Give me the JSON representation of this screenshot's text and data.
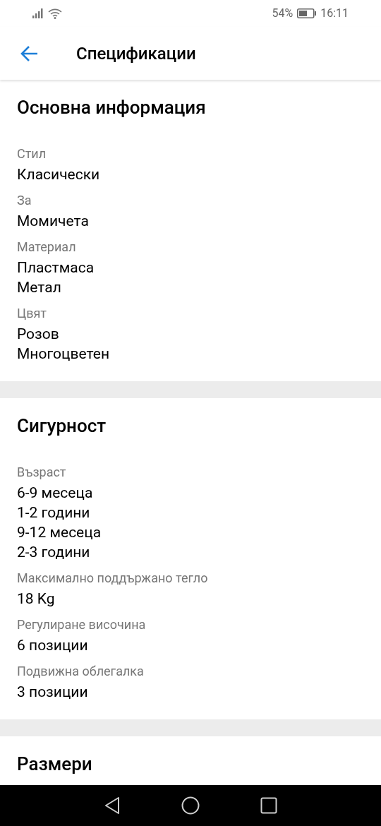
{
  "status_bar": {
    "battery_text": "54%",
    "time": "16:11"
  },
  "header": {
    "title": "Спецификации"
  },
  "sections": [
    {
      "title": "Основна информация",
      "specs": [
        {
          "label": "Стил",
          "values": [
            "Класически"
          ]
        },
        {
          "label": "За",
          "values": [
            "Момичета"
          ]
        },
        {
          "label": "Материал",
          "values": [
            "Пластмаса",
            "Метал"
          ]
        },
        {
          "label": "Цвят",
          "values": [
            "Розов",
            "Многоцветен"
          ]
        }
      ]
    },
    {
      "title": "Сигурност",
      "specs": [
        {
          "label": "Възраст",
          "values": [
            "6-9 месеца",
            "1-2 години",
            "9-12 месеца",
            "2-3 години"
          ]
        },
        {
          "label": "Максимално поддържано тегло",
          "values": [
            "18 Kg"
          ]
        },
        {
          "label": "Регулиране височина",
          "values": [
            "6 позиции"
          ]
        },
        {
          "label": "Подвижна облегалка",
          "values": [
            "3 позиции"
          ]
        }
      ]
    },
    {
      "title": "Размери"
    }
  ]
}
